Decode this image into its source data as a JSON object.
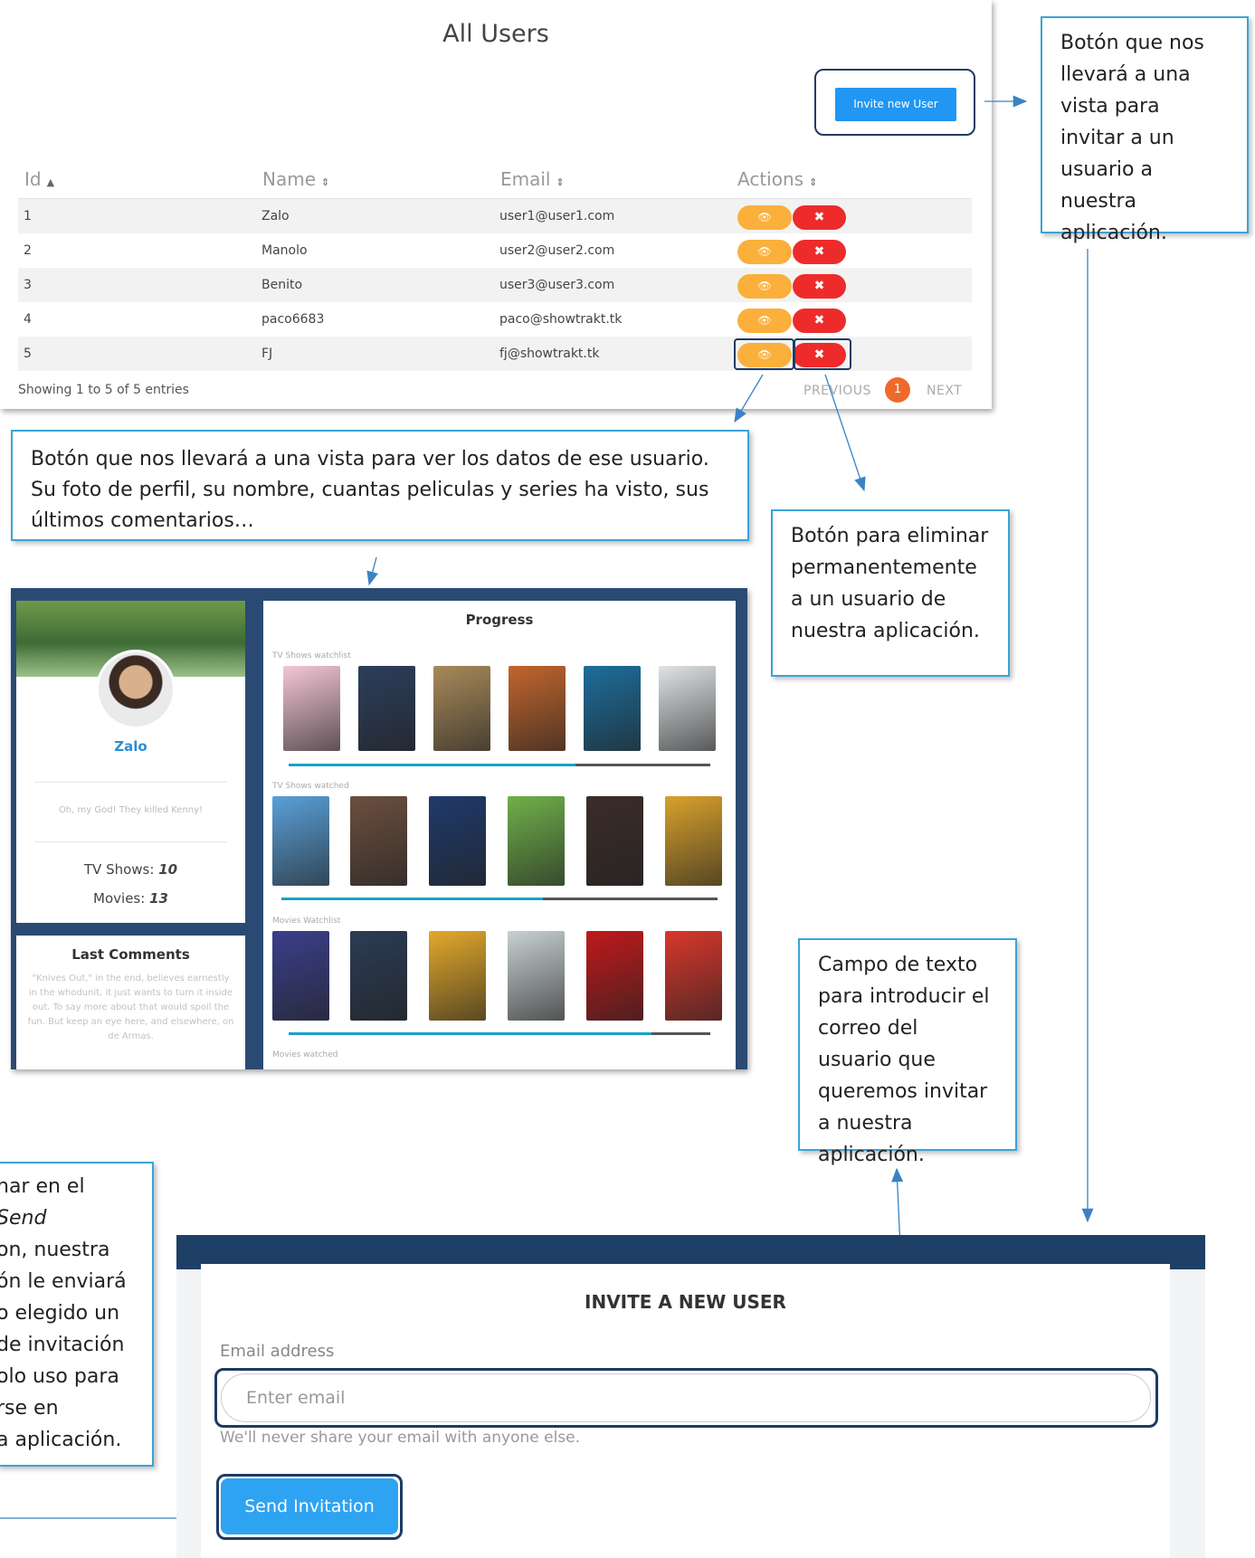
{
  "users_panel": {
    "title": "All Users",
    "invite_button": "Invite new User",
    "columns": [
      "Id",
      "Name",
      "Email",
      "Actions"
    ],
    "sort_icons": {
      "asc": "▲",
      "both": "⇕"
    },
    "rows": [
      {
        "id": "1",
        "name": "Zalo",
        "email": "user1@user1.com"
      },
      {
        "id": "2",
        "name": "Manolo",
        "email": "user2@user2.com"
      },
      {
        "id": "3",
        "name": "Benito",
        "email": "user3@user3.com"
      },
      {
        "id": "4",
        "name": "paco6683",
        "email": "paco@showtrakt.tk"
      },
      {
        "id": "5",
        "name": "FJ",
        "email": "fj@showtrakt.tk"
      }
    ],
    "action_icons": {
      "view": "eye-icon",
      "delete": "close-icon"
    },
    "showing": "Showing 1 to 5 of 5 entries",
    "pagination": {
      "previous": "PREVIOUS",
      "current": "1",
      "next": "NEXT"
    }
  },
  "callouts": {
    "invite": "Botón que nos llevará a una vista para invitar a un usuario a nuestra aplicación.",
    "view": "Botón que nos llevará a una vista para ver los datos de ese usuario. Su foto de perfil, su nombre, cuantas peliculas y series ha visto, sus últimos comentarios…",
    "delete": "Botón para eliminar permanentemente a un usuario de nuestra aplicación.",
    "email": "Campo de texto para introducir el correo del usuario que queremos invitar a nuestra aplicación.",
    "send_lines": [
      "nar en el",
      "Send",
      "on, nuestra",
      "ón le enviará",
      "o elegido un",
      "de invitación",
      "olo uso para",
      "rse en",
      "a aplicación."
    ]
  },
  "profile_view": {
    "name": "Zalo",
    "quote": "Oh, my God! They killed Kenny!",
    "tv_shows_label": "TV Shows:",
    "tv_shows_value": "10",
    "movies_label": "Movies:",
    "movies_value": "13",
    "comments_title": "Last Comments",
    "comments_text": "\"Knives Out,\" in the end, believes earnestly in the whodunit, it just wants to turn it inside out. To say more about that would spoil the fun. But keep an eye here, and elsewhere, on de Armas.",
    "progress_title": "Progress",
    "sections": [
      {
        "label": "TV Shows watchlist",
        "progress": 0.68
      },
      {
        "label": "TV Shows watched",
        "progress": 0.6
      },
      {
        "label": "Movies Watchlist",
        "progress": 0.86
      },
      {
        "label": "Movies watched",
        "progress": 0
      }
    ],
    "poster_colors": {
      "s0": [
        "#f4c6d6",
        "#2c3e5c",
        "#a88a5a",
        "#c2652c",
        "#1c6e9c",
        "#dfe3e6"
      ],
      "s1": [
        "#5aa0d8",
        "#6b4f3f",
        "#1f3a6b",
        "#6fb04a",
        "#3b2c28",
        "#d9a12b"
      ],
      "s2": [
        "#3a3f8a",
        "#2b3c55",
        "#e4a92a",
        "#c8d0d2",
        "#c0191b",
        "#d9372b"
      ]
    }
  },
  "invite_view": {
    "title": "INVITE A NEW USER",
    "email_label": "Email address",
    "email_placeholder": "Enter email",
    "email_value": "",
    "help_text": "We'll never share your email with anyone else.",
    "send_button": "Send Invitation"
  }
}
